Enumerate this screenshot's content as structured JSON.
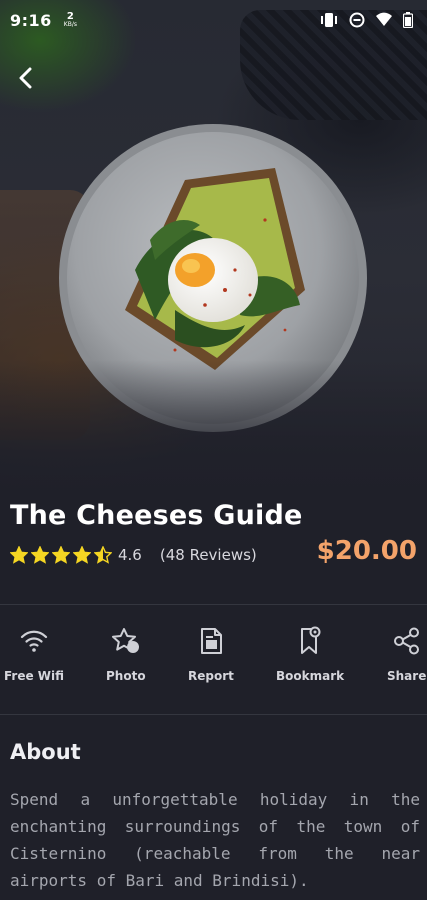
{
  "status_bar": {
    "time": "9:16",
    "net_speed": "2",
    "net_unit": "KB/s"
  },
  "header": {
    "back_icon": "arrow-back-icon"
  },
  "hero": {
    "image_subject": "avocado toast with poached egg on a grey plate"
  },
  "place": {
    "title": "The Cheeses Guide",
    "rating_value": "4.6",
    "rating_stars": 4.5,
    "reviews": "(48 Reviews)",
    "price": "$20.00"
  },
  "actions": [
    {
      "label": "Free Wifi",
      "icon": "wifi-icon"
    },
    {
      "label": "Photo",
      "icon": "photo-star-icon"
    },
    {
      "label": "Report",
      "icon": "report-icon"
    },
    {
      "label": "Bookmark",
      "icon": "bookmark-icon"
    },
    {
      "label": "Share",
      "icon": "share-icon"
    }
  ],
  "about": {
    "title": "About",
    "text": "Spend a unforgettable holiday in the enchanting surroundings of the town of Cisternino (reachable from the near airports of Bari and Brindisi)."
  },
  "colors": {
    "background": "#1f2029",
    "price": "#f4a36a",
    "star": "#f5d623",
    "divider": "#34363f",
    "body_text": "#a4a6ae"
  }
}
